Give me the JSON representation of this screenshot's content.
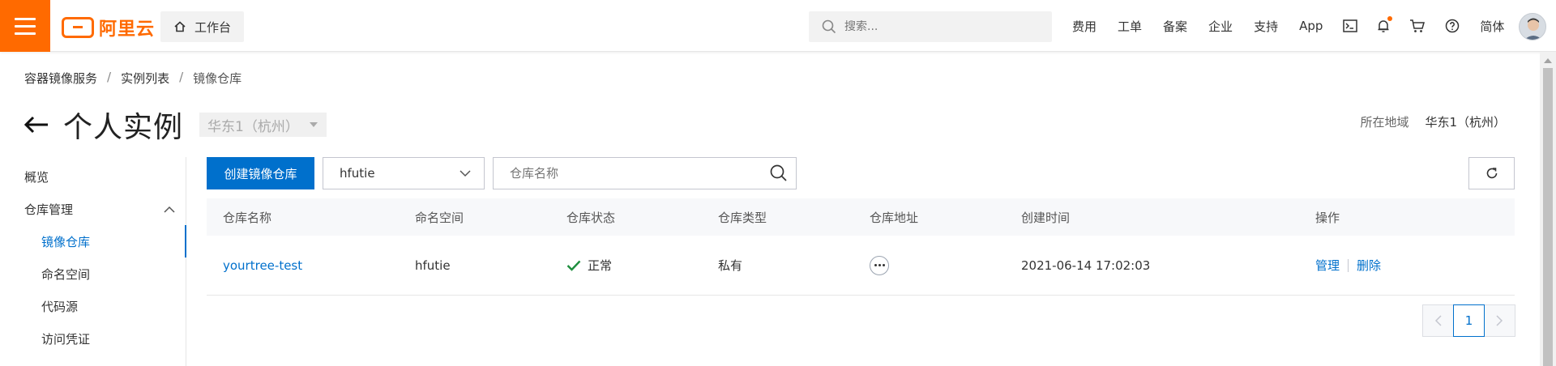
{
  "topbar": {
    "brand": "阿里云",
    "workbench_label": "工作台",
    "search_placeholder": "搜索...",
    "nav": [
      "费用",
      "工单",
      "备案",
      "企业",
      "支持",
      "App"
    ],
    "lang": "简体"
  },
  "breadcrumb": [
    "容器镜像服务",
    "实例列表",
    "镜像仓库"
  ],
  "header": {
    "title": "个人实例",
    "region_select": "华东1（杭州）",
    "region_label": "所在地域",
    "region_value": "华东1（杭州）"
  },
  "sidebar": {
    "items": [
      {
        "label": "概览"
      },
      {
        "label": "仓库管理"
      },
      {
        "label": "镜像仓库"
      },
      {
        "label": "命名空间"
      },
      {
        "label": "代码源"
      },
      {
        "label": "访问凭证"
      }
    ]
  },
  "toolbar": {
    "create_label": "创建镜像仓库",
    "namespace_value": "hfutie",
    "name_search_placeholder": "仓库名称"
  },
  "table": {
    "columns": [
      "仓库名称",
      "命名空间",
      "仓库状态",
      "仓库类型",
      "仓库地址",
      "创建时间",
      "操作"
    ],
    "rows": [
      {
        "name": "yourtree-test",
        "namespace": "hfutie",
        "status": "正常",
        "type": "私有",
        "created": "2021-06-14 17:02:03",
        "op_manage": "管理",
        "op_delete": "删除"
      }
    ]
  },
  "pagination": {
    "current": "1"
  },
  "colors": {
    "brand_orange": "#ff6a00",
    "primary_blue": "#0070cc",
    "success_green": "#1e8e3e"
  }
}
